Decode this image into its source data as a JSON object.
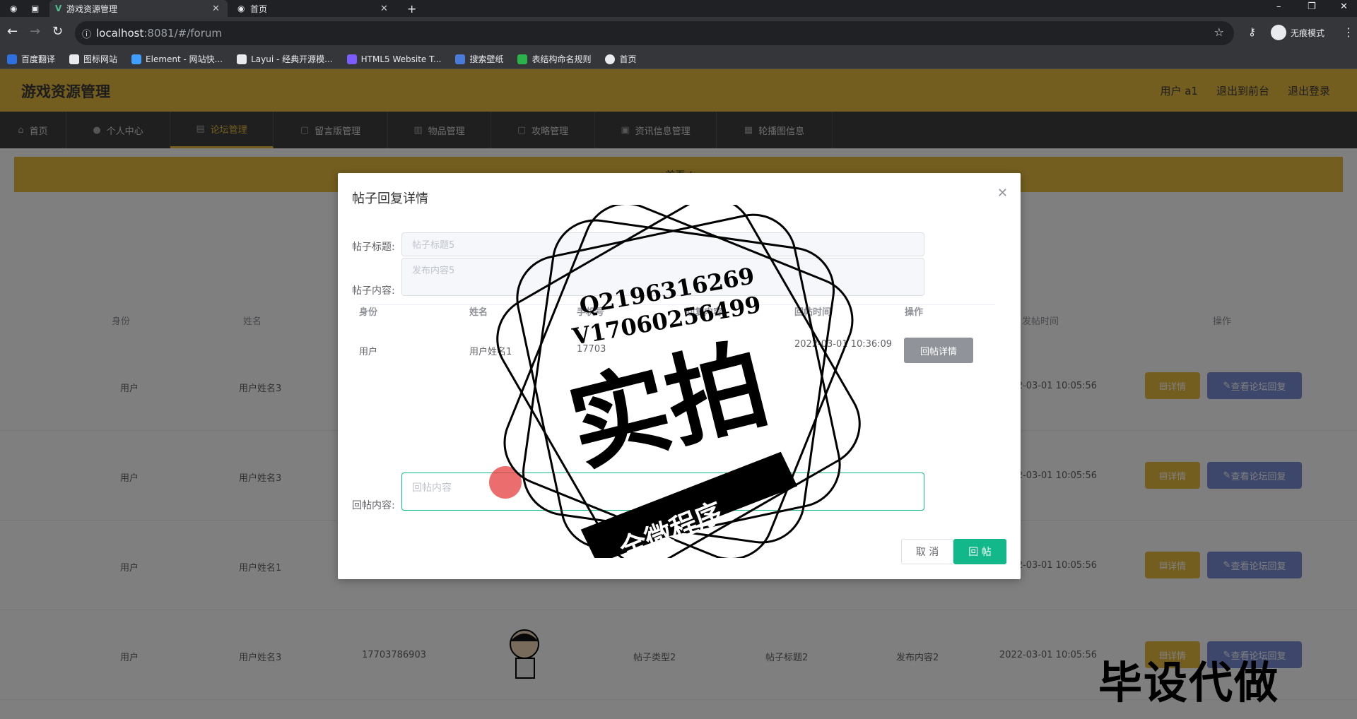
{
  "browser": {
    "tabs": [
      {
        "label": "游戏资源管理",
        "active": true
      },
      {
        "label": "首页",
        "active": false
      }
    ],
    "url_host": "localhost",
    "url_rest": ":8081/#/forum",
    "profile_label": "无痕模式",
    "bookmarks": [
      "百度翻译",
      "图标网站",
      "Element - 网站快...",
      "Layui - 经典开源模...",
      "HTML5 Website T...",
      "搜索壁纸",
      "表结构命名规则",
      "首页"
    ]
  },
  "app": {
    "title": "游戏资源管理",
    "header_links": [
      "用户 a1",
      "退出到前台",
      "退出登录"
    ],
    "menu": [
      "首页",
      "个人中心",
      "论坛管理",
      "留言版管理",
      "物品管理",
      "攻略管理",
      "资讯信息管理",
      "轮播图信息"
    ],
    "active_menu": "论坛管理",
    "banner_text": "首页 /",
    "table": {
      "headers": [
        "身份",
        "姓名",
        "发帖时间",
        "操作"
      ],
      "rows": [
        {
          "role": "用户",
          "name": "用户姓名3",
          "phone": "",
          "type": "",
          "title": "",
          "content": "",
          "time": "2022-03-01 10:05:56"
        },
        {
          "role": "用户",
          "name": "用户姓名3",
          "phone": "",
          "type": "",
          "title": "",
          "content": "",
          "time": "2022-03-01 10:05:56"
        },
        {
          "role": "用户",
          "name": "用户姓名1",
          "phone": "",
          "type": "",
          "title": "",
          "content": "",
          "time": "2022-03-01 10:05:56"
        },
        {
          "role": "用户",
          "name": "用户姓名3",
          "phone": "17703786903",
          "type": "帖子类型2",
          "title": "帖子标题2",
          "content": "发布内容2",
          "time": "2022-03-01 10:05:56"
        }
      ],
      "detail_label": "详情",
      "reply_label": "查看论坛回复"
    }
  },
  "dialog": {
    "title": "帖子回复详情",
    "title_label": "帖子标题:",
    "title_value": "帖子标题5",
    "content_label": "帖子内容:",
    "content_value": "发布内容5",
    "inner_headers": [
      "身份",
      "姓名",
      "手机号",
      "回复内容",
      "回帖时间",
      "操作"
    ],
    "inner_row": {
      "role": "用户",
      "name": "用户姓名1",
      "phone": "17703",
      "time": "2022-03-01 10:36:09"
    },
    "reply_detail_label": "回帖详情",
    "reply_label": "回帖内容:",
    "reply_placeholder": "回帖内容",
    "cancel_label": "取 消",
    "submit_label": "回 帖"
  },
  "watermark": {
    "line1": "Q2196316269",
    "line2": "V17060256499",
    "big": "实拍",
    "ribbon": "全微程序",
    "corner": "毕设代做"
  }
}
